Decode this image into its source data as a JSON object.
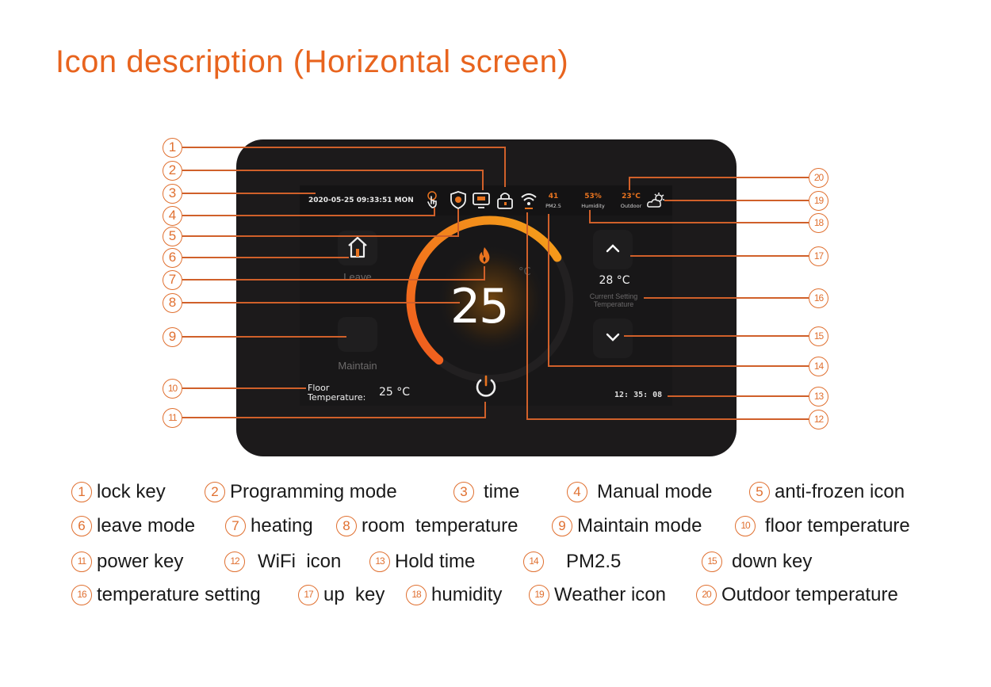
{
  "title": "Icon description (Horizontal screen)",
  "colors": {
    "accent": "#e8641e",
    "device": "#1c1a1b",
    "screen": "#181718",
    "leader": "#d0602a"
  },
  "screen": {
    "status_bar": {
      "datetime": "2020-05-25  09:33:51  MON",
      "icons": [
        "manual-mode-hand-icon",
        "anti-frozen-shield-icon",
        "programming-monitor-icon",
        "lock-icon",
        "wifi-icon"
      ],
      "pm25": {
        "value": "41",
        "label": "PM2.5"
      },
      "humidity": {
        "value": "53%",
        "label": "Humidity"
      },
      "outdoor": {
        "value": "23°C",
        "label": "Outdoor"
      },
      "weather_icon": "partly-cloudy-sun-icon"
    },
    "leave_label": "Leave",
    "maintain_label": "Maintain",
    "room_temperature": "25",
    "room_unit": "°C",
    "heating_icon": "flame-icon",
    "set_temperature": "28 °C",
    "set_label_line1": "Current Setting",
    "set_label_line2": "Temperature",
    "floor_label_line1": "Floor",
    "floor_label_line2": "Temperature:",
    "floor_value": "25 °C",
    "hold_time": "12: 35: 08",
    "dial_progress_fraction": 0.55
  },
  "callouts": {
    "left": [
      "1",
      "2",
      "3",
      "4",
      "5",
      "6",
      "7",
      "8",
      "9",
      "10",
      "11"
    ],
    "right": [
      "20",
      "19",
      "18",
      "17",
      "16",
      "15",
      "14",
      "13",
      "12"
    ]
  },
  "legend": [
    [
      {
        "n": "1",
        "label": "lock key"
      },
      {
        "n": "2",
        "label": "Programming mode"
      },
      {
        "n": "3",
        "label": "time"
      },
      {
        "n": "4",
        "label": "Manual mode"
      },
      {
        "n": "5",
        "label": "anti-frozen icon"
      }
    ],
    [
      {
        "n": "6",
        "label": "leave mode"
      },
      {
        "n": "7",
        "label": "heating"
      },
      {
        "n": "8",
        "label": "room  temperature"
      },
      {
        "n": "9",
        "label": "Maintain mode"
      },
      {
        "n": "10",
        "label": "floor temperature"
      }
    ],
    [
      {
        "n": "11",
        "label": "power key"
      },
      {
        "n": "12",
        "label": "WiFi  icon"
      },
      {
        "n": "13",
        "label": "Hold time"
      },
      {
        "n": "14",
        "label": "PM2.5"
      },
      {
        "n": "15",
        "label": "down key"
      }
    ],
    [
      {
        "n": "16",
        "label": "temperature setting"
      },
      {
        "n": "17",
        "label": "up  key"
      },
      {
        "n": "18",
        "label": "humidity"
      },
      {
        "n": "19",
        "label": "Weather icon"
      },
      {
        "n": "20",
        "label": "Outdoor temperature"
      }
    ]
  ]
}
